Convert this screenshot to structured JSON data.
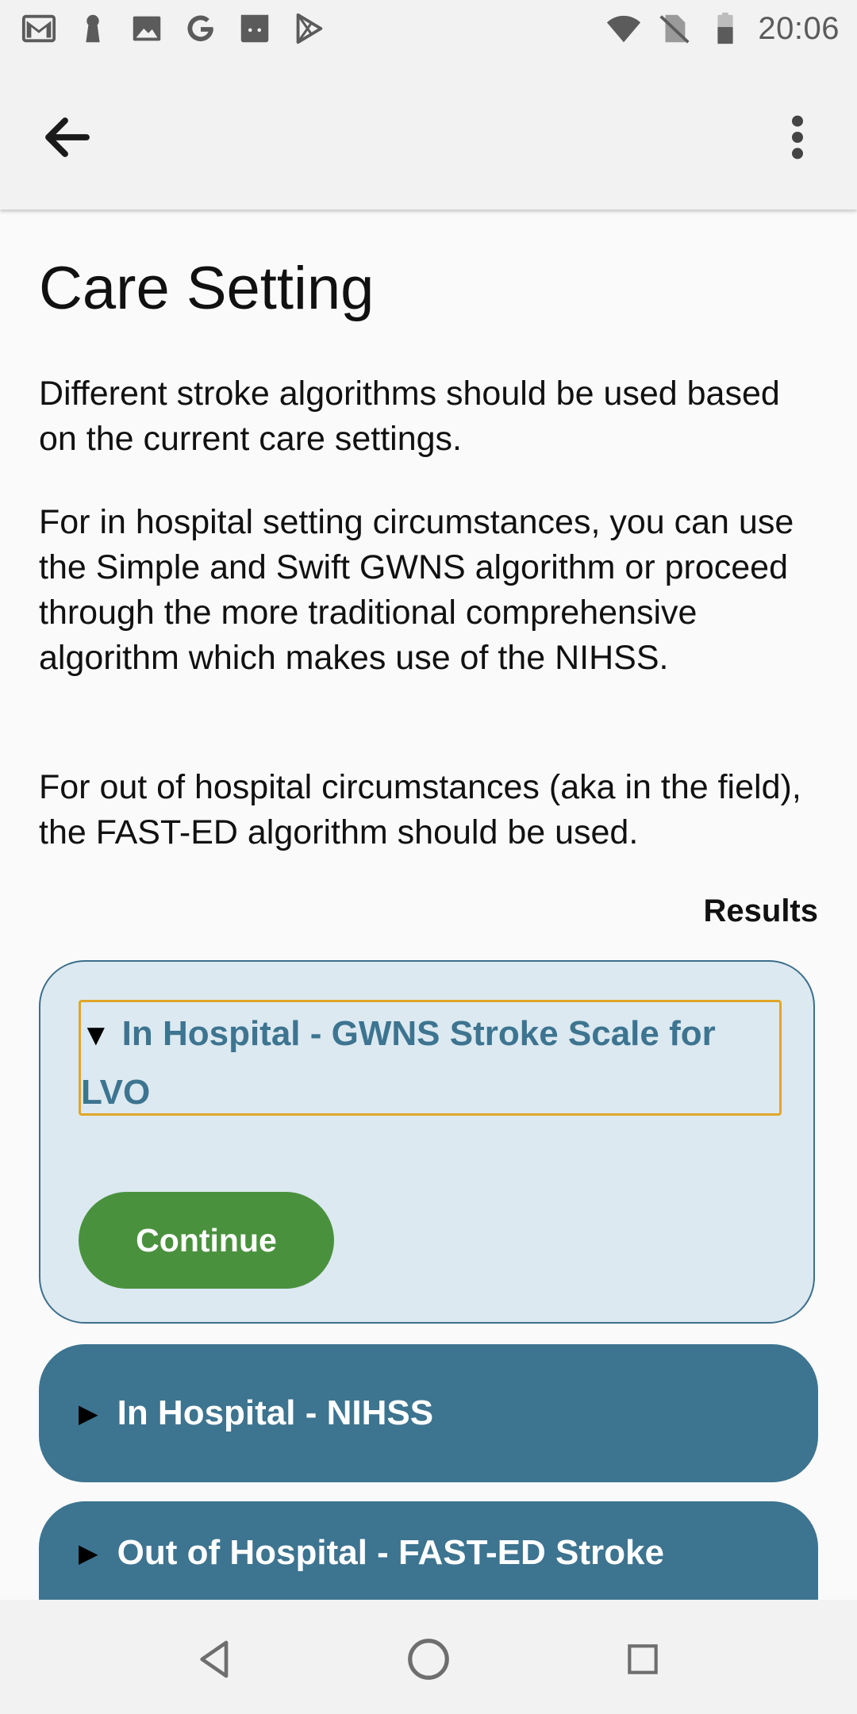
{
  "status_bar": {
    "time": "20:06",
    "left_icons": [
      "gmail-icon",
      "keyhole-icon",
      "image-icon",
      "google-icon",
      "android-box-icon",
      "play-store-icon"
    ],
    "right_icons": [
      "wifi-icon",
      "no-sim-icon",
      "battery-icon"
    ]
  },
  "app_bar": {
    "back_icon": "arrow-back-icon",
    "menu_icon": "more-vert-icon"
  },
  "page": {
    "title": "Care Setting",
    "paragraphs": [
      "Different stroke algorithms should be used based on the current care settings.",
      "For in hospital setting circumstances, you can use the Simple and Swift GWNS algorithm or proceed through the more traditional comprehensive algorithm which makes use of the NIHSS.",
      "For out of hospital circumstances (aka in the field), the FAST-ED algorithm should be used."
    ],
    "results_label": "Results"
  },
  "options": [
    {
      "label": "In Hospital - GWNS Stroke Scale for LVO",
      "expanded": true,
      "action_label": "Continue"
    },
    {
      "label": "In Hospital - NIHSS",
      "expanded": false
    },
    {
      "label": "Out of Hospital - FAST-ED Stroke",
      "expanded": false
    }
  ],
  "colors": {
    "accent": "#3d7490",
    "continue": "#4a913e",
    "focus_outline": "#e1a628",
    "expanded_card_bg": "#dce9f1"
  },
  "nav_bar": {
    "icons": [
      "nav-back-icon",
      "nav-home-icon",
      "nav-recents-icon"
    ]
  }
}
